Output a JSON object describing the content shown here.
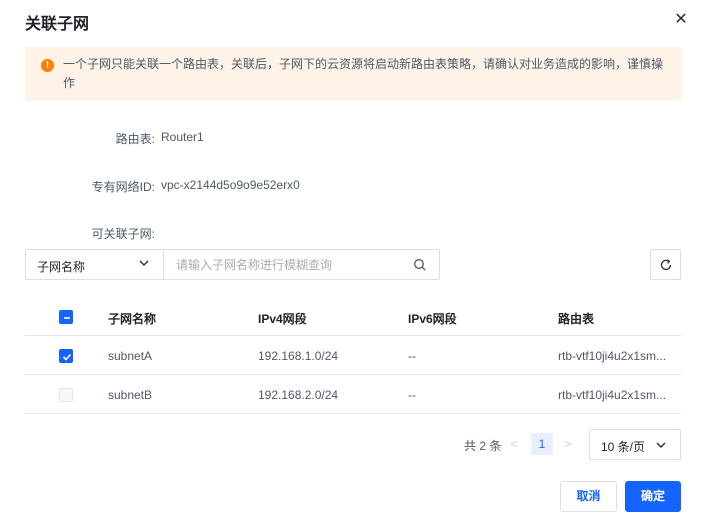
{
  "dialog": {
    "title": "关联子网",
    "close_icon": "close-icon"
  },
  "notice": {
    "icon": "warning-icon",
    "text": "一个子网只能关联一个路由表，关联后，子网下的云资源将启动新路由表策略，请确认对业务造成的影响，谨慎操作"
  },
  "info": {
    "route_table_label": "路由表:",
    "route_table_value": "Router1",
    "vpc_label": "专有网络ID:",
    "vpc_value": "vpc-x2144d5o9o9e52erx0",
    "subnets_label": "可关联子网:"
  },
  "filter": {
    "field_selected": "子网名称",
    "search_placeholder": "请输入子网名称进行模糊查询",
    "search_value": ""
  },
  "table": {
    "headers": {
      "name": "子网名称",
      "ipv4": "IPv4网段",
      "ipv6": "IPv6网段",
      "route_table": "路由表"
    },
    "rows": [
      {
        "checked": true,
        "name": "subnetA",
        "ipv4": "192.168.1.0/24",
        "ipv6": "--",
        "route_table": "rtb-vtf10ji4u2x1sm..."
      },
      {
        "checked": false,
        "name": "subnetB",
        "ipv4": "192.168.2.0/24",
        "ipv6": "--",
        "route_table": "rtb-vtf10ji4u2x1sm..."
      }
    ]
  },
  "pagination": {
    "total": "共 2 条",
    "prev": "<",
    "current_page": "1",
    "next": ">",
    "page_size": "10 条/页"
  },
  "footer": {
    "cancel_label": "取消",
    "ok_label": "确定"
  },
  "colors": {
    "primary": "#1664ff",
    "warning": "#ff7d00",
    "notice_bg": "#fff3e8"
  }
}
